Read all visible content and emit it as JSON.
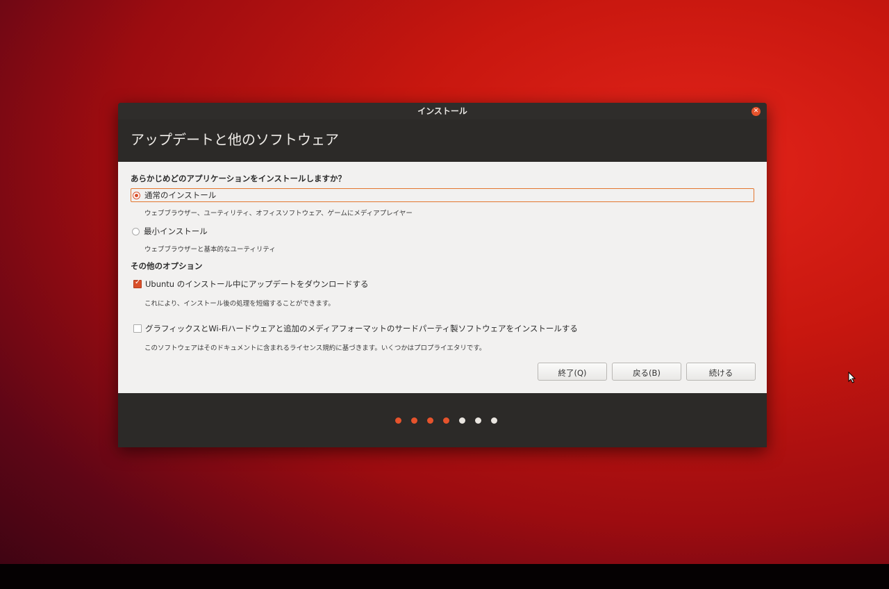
{
  "window": {
    "title": "インストール"
  },
  "page": {
    "heading": "アップデートと他のソフトウェア"
  },
  "install_type": {
    "question": "あらかじめどのアプリケーションをインストールしますか？",
    "options": [
      {
        "label": "通常のインストール",
        "description": "ウェブブラウザー、ユーティリティ、オフィスソフトウェア、ゲームにメディアプレイヤー",
        "selected": true
      },
      {
        "label": "最小インストール",
        "description": "ウェブブラウザーと基本的なユーティリティ",
        "selected": false
      }
    ]
  },
  "other_options": {
    "title": "その他のオプション",
    "items": [
      {
        "label": "Ubuntu のインストール中にアップデートをダウンロードする",
        "description": "これにより、インストール後の処理を短縮することができます。",
        "checked": true
      },
      {
        "label": "グラフィックスとWi-Fiハードウェアと追加のメディアフォーマットのサードパーティ製ソフトウェアをインストールする",
        "description": "このソフトウェアはそのドキュメントに含まれるライセンス規約に基づきます。いくつかはプロプライエタリです。",
        "checked": false
      }
    ]
  },
  "buttons": {
    "quit": "終了(Q)",
    "back": "戻る(B)",
    "continue": "続ける"
  },
  "progress": {
    "total_steps": 7,
    "completed_steps": 4
  },
  "colors": {
    "accent": "#e6532c",
    "dialog_dark": "#2c2a28",
    "content_bg": "#f2f1f0"
  }
}
